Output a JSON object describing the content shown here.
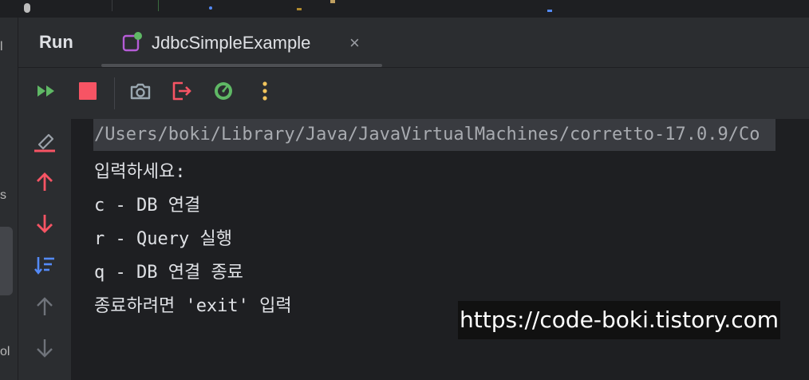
{
  "window": {
    "tool_window_title": "Run",
    "tab": {
      "label": "JdbcSimpleExample",
      "close_glyph": "×",
      "icon": "class-run-icon"
    }
  },
  "left_strip": {
    "fragments": [
      "l",
      "s",
      "ol"
    ]
  },
  "toolbar": {
    "buttons": [
      {
        "name": "rerun-icon",
        "color": "#5fb865"
      },
      {
        "name": "stop-icon",
        "color": "#f75464"
      },
      {
        "name": "camera-icon",
        "color": "#9aa7b0"
      },
      {
        "name": "exit-icon",
        "color": "#f75464"
      },
      {
        "name": "profiler-icon",
        "color": "#5fb865"
      },
      {
        "name": "more-icon",
        "color": "#f2c55c"
      }
    ]
  },
  "gutter": {
    "buttons": [
      {
        "name": "clear-all-icon"
      },
      {
        "name": "up-stack-trace-icon"
      },
      {
        "name": "down-stack-trace-icon"
      },
      {
        "name": "sort-icon"
      },
      {
        "name": "scroll-up-icon"
      },
      {
        "name": "scroll-down-icon"
      }
    ]
  },
  "console": {
    "command": "/Users/boki/Library/Java/JavaVirtualMachines/corretto-17.0.9/Co",
    "lines": [
      "입력하세요:",
      "c - DB 연결",
      "r - Query 실행",
      "q - DB 연결 종료",
      "종료하려면 'exit' 입력"
    ]
  },
  "watermark": "https://code-boki.tistory.com",
  "colors": {
    "bg_panel": "#2b2d30",
    "bg_console": "#1e1f22",
    "text": "#dfe1e5",
    "accent_red": "#f75464",
    "accent_green": "#5fb865",
    "accent_blue": "#548af7",
    "accent_yellow": "#f2c55c"
  }
}
